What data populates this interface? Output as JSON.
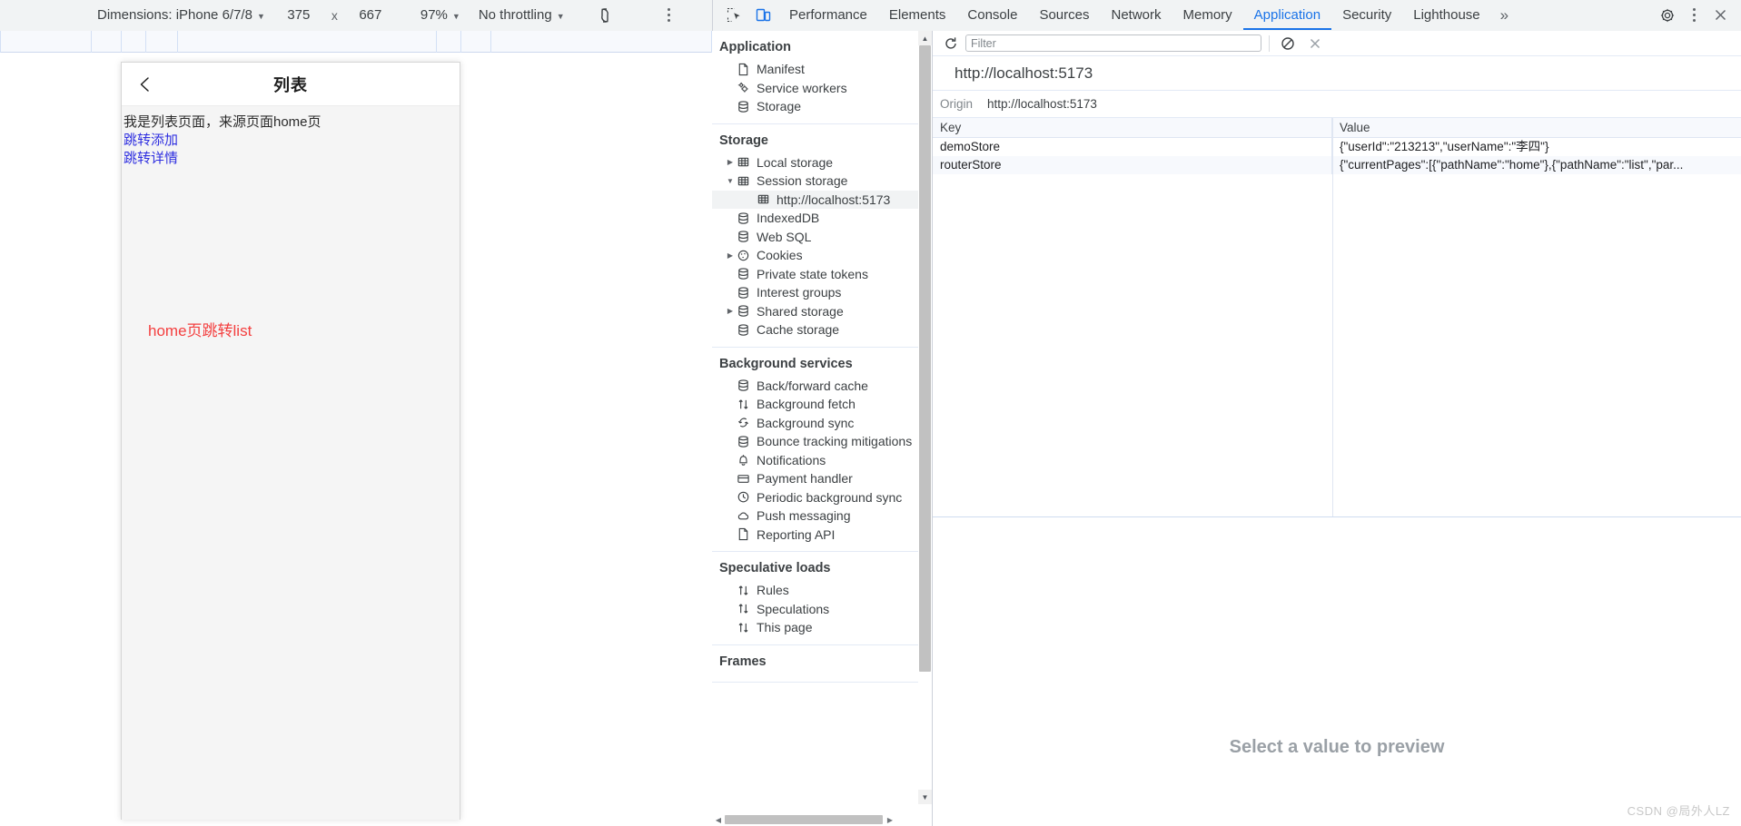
{
  "device_toolbar": {
    "dimensions_label": "Dimensions: iPhone 6/7/8",
    "width_value": "375",
    "times": "x",
    "height_value": "667",
    "zoom_label": "97%",
    "throttling_label": "No throttling",
    "rotate_icon": "rotate-icon",
    "more_icon": "more-options-icon"
  },
  "devtools": {
    "inspect_icon": "inspect-element-icon",
    "device_toggle_icon": "toggle-device-toolbar-icon",
    "tabs": [
      {
        "label": "Performance",
        "active": false
      },
      {
        "label": "Elements",
        "active": false
      },
      {
        "label": "Console",
        "active": false
      },
      {
        "label": "Sources",
        "active": false
      },
      {
        "label": "Network",
        "active": false
      },
      {
        "label": "Memory",
        "active": false
      },
      {
        "label": "Application",
        "active": true
      },
      {
        "label": "Security",
        "active": false
      },
      {
        "label": "Lighthouse",
        "active": false
      }
    ],
    "more_tabs_label": "»",
    "settings_icon": "gear-icon",
    "kebab_icon": "more-tools-icon",
    "close_icon": "close-icon",
    "accent_color": "#1a73e8"
  },
  "phone": {
    "back_icon": "back-arrow-icon",
    "title": "列表",
    "body_text": "我是列表页面，来源页面home页",
    "link_add": "跳转添加",
    "link_detail": "跳转详情",
    "red_text": "home页跳转list",
    "red_color": "#f43f3f",
    "link_color": "#2f2fe0"
  },
  "sidebar": {
    "groups": [
      {
        "title": "Application",
        "items": [
          {
            "label": "Manifest",
            "icon": "document-icon",
            "arrow": "none",
            "indent": 1,
            "selected": false
          },
          {
            "label": "Service workers",
            "icon": "gears-icon",
            "arrow": "none",
            "indent": 1,
            "selected": false
          },
          {
            "label": "Storage",
            "icon": "database-icon",
            "arrow": "none",
            "indent": 1,
            "selected": false
          }
        ]
      },
      {
        "title": "Storage",
        "items": [
          {
            "label": "Local storage",
            "icon": "table-icon",
            "arrow": "collapsed",
            "indent": 1,
            "selected": false
          },
          {
            "label": "Session storage",
            "icon": "table-icon",
            "arrow": "expanded",
            "indent": 1,
            "selected": false
          },
          {
            "label": "http://localhost:5173",
            "icon": "table-icon",
            "arrow": "none",
            "indent": 2,
            "selected": true
          },
          {
            "label": "IndexedDB",
            "icon": "database-icon",
            "arrow": "none",
            "indent": 1,
            "selected": false
          },
          {
            "label": "Web SQL",
            "icon": "database-icon",
            "arrow": "none",
            "indent": 1,
            "selected": false
          },
          {
            "label": "Cookies",
            "icon": "cookie-icon",
            "arrow": "collapsed",
            "indent": 1,
            "selected": false
          },
          {
            "label": "Private state tokens",
            "icon": "database-icon",
            "arrow": "none",
            "indent": 1,
            "selected": false
          },
          {
            "label": "Interest groups",
            "icon": "database-icon",
            "arrow": "none",
            "indent": 1,
            "selected": false
          },
          {
            "label": "Shared storage",
            "icon": "database-icon",
            "arrow": "collapsed",
            "indent": 1,
            "selected": false
          },
          {
            "label": "Cache storage",
            "icon": "database-icon",
            "arrow": "none",
            "indent": 1,
            "selected": false
          }
        ]
      },
      {
        "title": "Background services",
        "items": [
          {
            "label": "Back/forward cache",
            "icon": "database-icon",
            "arrow": "none",
            "indent": 1,
            "selected": false
          },
          {
            "label": "Background fetch",
            "icon": "updown-arrows-icon",
            "arrow": "none",
            "indent": 1,
            "selected": false
          },
          {
            "label": "Background sync",
            "icon": "sync-icon",
            "arrow": "none",
            "indent": 1,
            "selected": false
          },
          {
            "label": "Bounce tracking mitigations",
            "icon": "database-icon",
            "arrow": "none",
            "indent": 1,
            "selected": false
          },
          {
            "label": "Notifications",
            "icon": "bell-icon",
            "arrow": "none",
            "indent": 1,
            "selected": false
          },
          {
            "label": "Payment handler",
            "icon": "credit-card-icon",
            "arrow": "none",
            "indent": 1,
            "selected": false
          },
          {
            "label": "Periodic background sync",
            "icon": "clock-icon",
            "arrow": "none",
            "indent": 1,
            "selected": false
          },
          {
            "label": "Push messaging",
            "icon": "cloud-icon",
            "arrow": "none",
            "indent": 1,
            "selected": false
          },
          {
            "label": "Reporting API",
            "icon": "document-icon",
            "arrow": "none",
            "indent": 1,
            "selected": false
          }
        ]
      },
      {
        "title": "Speculative loads",
        "items": [
          {
            "label": "Rules",
            "icon": "updown-arrows-icon",
            "arrow": "none",
            "indent": 1,
            "selected": false
          },
          {
            "label": "Speculations",
            "icon": "updown-arrows-icon",
            "arrow": "none",
            "indent": 1,
            "selected": false
          },
          {
            "label": "This page",
            "icon": "updown-arrows-icon",
            "arrow": "none",
            "indent": 1,
            "selected": false
          }
        ]
      },
      {
        "title": "Frames",
        "items": []
      }
    ]
  },
  "main": {
    "refresh_icon": "refresh-icon",
    "filter_placeholder": "Filter",
    "clear_icon": "clear-all-icon",
    "delete_icon": "delete-selected-icon",
    "origin_heading": "http://localhost:5173",
    "origin_label": "Origin",
    "origin_value": "http://localhost:5173",
    "columns": [
      "Key",
      "Value"
    ],
    "rows": [
      {
        "key": "demoStore",
        "value": "{\"userId\":\"213213\",\"userName\":\"李四\"}"
      },
      {
        "key": "routerStore",
        "value": "{\"currentPages\":[{\"pathName\":\"home\"},{\"pathName\":\"list\",\"par..."
      }
    ],
    "preview_placeholder": "Select a value to preview"
  },
  "watermark": "CSDN @局外人LZ"
}
